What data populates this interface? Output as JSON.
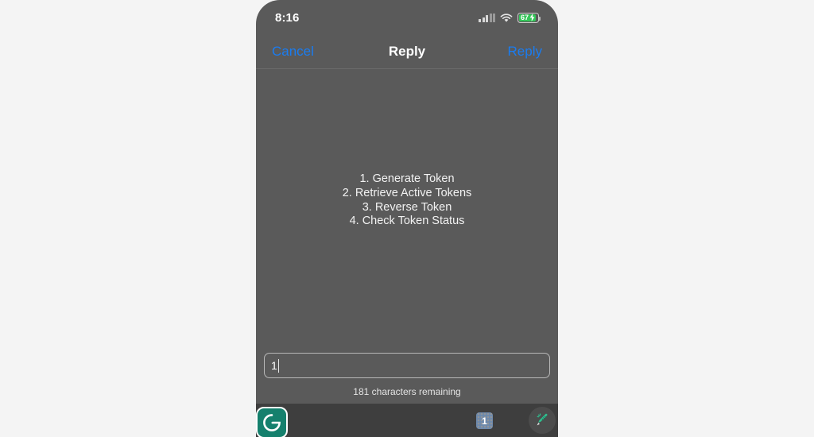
{
  "status_bar": {
    "time": "8:16",
    "cellular_icon": "cellular-signal-icon",
    "wifi_icon": "wifi-icon",
    "battery_percent": "67",
    "battery_icon": "battery-charging-icon",
    "battery_color": "#34c759"
  },
  "nav_bar": {
    "cancel_label": "Cancel",
    "title": "Reply",
    "reply_label": "Reply",
    "accent_color": "#1a7cf0"
  },
  "message": {
    "lines": [
      "1. Generate Token",
      "2. Retrieve Active Tokens",
      "3. Reverse Token",
      "4. Check Token Status"
    ]
  },
  "input": {
    "value": "1",
    "placeholder": "",
    "char_counter": "181 characters remaining"
  },
  "keyboard_toolbar": {
    "logo_icon": "grammarly-logo-icon",
    "logo_letter": "G",
    "logo_color": "#15806d",
    "suggestion_icon": "number-suggestion-icon",
    "suggestion_label": "1",
    "assistant_icon": "grammarly-assistant-pencil-icon",
    "assistant_color": "#2fbf8f"
  }
}
